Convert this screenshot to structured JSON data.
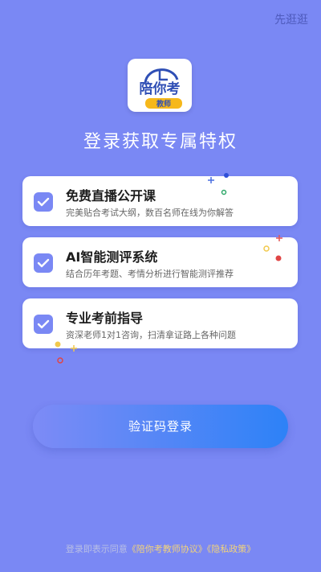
{
  "header": {
    "skip_label": "先逛逛"
  },
  "logo": {
    "main_text": "陪你考",
    "sub_text": "教师"
  },
  "headline": "登录获取专属特权",
  "features": [
    {
      "title": "免费直播公开课",
      "description": "完美贴合考试大纲，数百名师在线为你解答"
    },
    {
      "title": "AI智能测评系统",
      "description": "结合历年考题、考情分析进行智能测评推荐"
    },
    {
      "title": "专业考前指导",
      "description": "资深老师1对1咨询，扫清拿证路上各种问题"
    }
  ],
  "login_button": {
    "label": "验证码登录"
  },
  "agreement": {
    "prefix": "登录即表示同意",
    "link_1": "《陪你考教师协议》",
    "link_2": "《隐私政策》"
  },
  "colors": {
    "background": "#7a88f4",
    "button_start": "#7d8bf6",
    "button_end": "#2d82f7",
    "link": "#f2d37a",
    "logo_accent": "#f6b81a",
    "logo_blue": "#2f4fb5"
  }
}
